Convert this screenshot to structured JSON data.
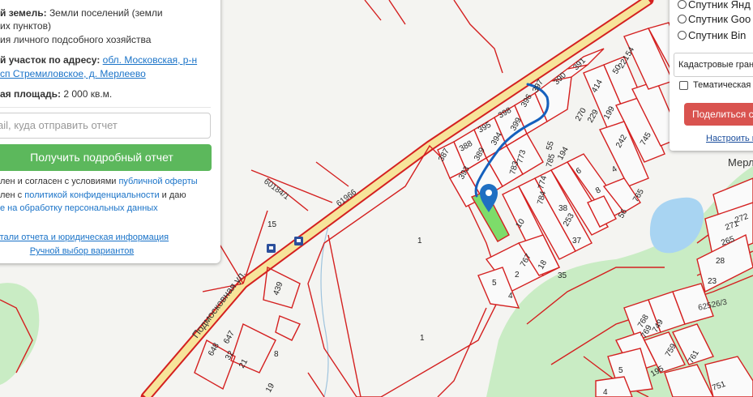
{
  "panel": {
    "land_category_label": "й земель:",
    "land_category_value_1": "Земли поселений (земли",
    "land_category_value_2": "их пунктов)",
    "land_use_value": "ия личного подсобного хозяйства",
    "address_label": "й участок по адресу:",
    "address_link_1": "обл. Московская, р-н",
    "address_link_2": "сп Стремиловское, д. Мерлеево",
    "area_label": "ая площадь:",
    "area_value": "2 000",
    "area_unit": "кв.м.",
    "email_placeholder": "ail, куда отправить отчет",
    "get_report_button": "Получить подробный отчет",
    "consent_1_prefix": "лен и согласен с условиями ",
    "consent_1_link": "публичной оферты",
    "consent_2_prefix": "лен с ",
    "consent_2_link": "политикой конфиденциальности",
    "consent_2_suffix": " и даю",
    "consent_3_link": "е на обработку персональных данных",
    "details_link": "етали отчета и юридическая информация",
    "manual_link": "Ручной выбор вариантов"
  },
  "layers": {
    "options": [
      "Спутник Янд",
      "Спутник Goo",
      "Спутник Bin"
    ],
    "select_value": "Кадастровые гран",
    "thematic_label": "Тематическая",
    "share_button": "Поделиться с",
    "configure_link": "Настроить к"
  },
  "map": {
    "place_label": "Мерл",
    "street_label": "Подмосковная ул.",
    "road_number": "61966",
    "road_code_1": "60184/1",
    "road_code_2": "62526/3",
    "colors": {
      "border": "#d42020",
      "road": "#f7e49a",
      "route": "#1560bd",
      "parcel": "#7ddc6a",
      "forest": "#c9ecc4",
      "water": "#a8d4f2",
      "marker": "#1f6fc2"
    },
    "parcel_numbers": [
      "15",
      "1",
      "1",
      "439",
      "648",
      "647",
      "32",
      "21",
      "8",
      "19",
      "2",
      "5",
      "4",
      "767",
      "18",
      "35",
      "10",
      "37",
      "387",
      "393",
      "388",
      "389",
      "395",
      "394",
      "398",
      "399",
      "396",
      "397",
      "390",
      "391",
      "773",
      "783",
      "774",
      "784",
      "55",
      "785",
      "194",
      "6",
      "8",
      "253",
      "56",
      "765",
      "414",
      "270",
      "199",
      "229",
      "242",
      "4",
      "745",
      "54",
      "221",
      "50",
      "271",
      "272",
      "265",
      "28",
      "23",
      "768",
      "749",
      "769",
      "759",
      "761",
      "195",
      "5",
      "751",
      "4",
      "38"
    ]
  }
}
